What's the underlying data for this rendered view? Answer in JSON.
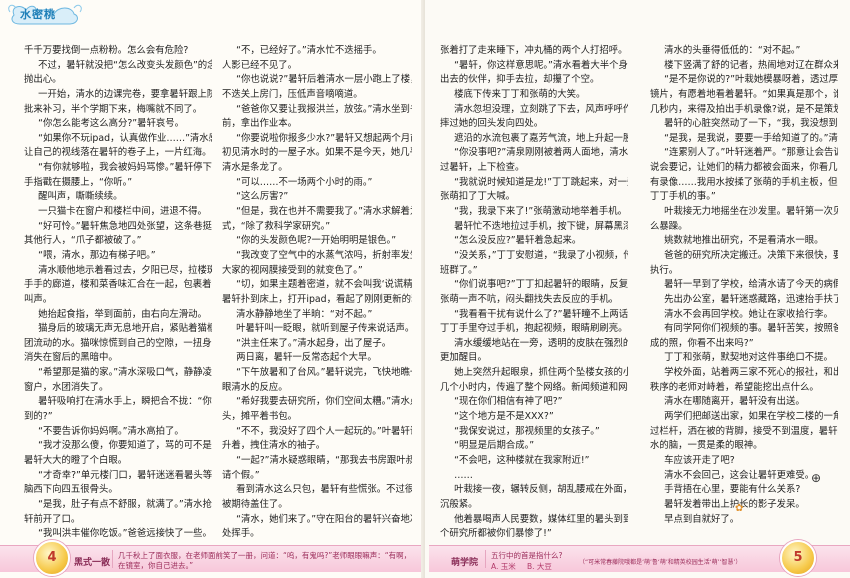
{
  "magazine": {
    "logo": "水密桃"
  },
  "left_page": {
    "col1": [
      {
        "t": "千千万要找倒一点粉粉。怎么会有危险?",
        "i": false
      },
      {
        "t": "不过，暑轩就没把“怎么改变头发颜色”的念头",
        "i": true
      },
      {
        "t": "抛出心。",
        "i": false
      },
      {
        "t": "一开始，清水的边课完卷，要拿暑轩跟上院外开小",
        "i": true
      },
      {
        "t": "批来补习，半个学期下来，梅嘴就不同了。",
        "i": false
      },
      {
        "t": "“你怎么能考这么高分?”暑轩哀号。",
        "i": true
      },
      {
        "t": "“如果你不玩ipad，认真做作业……”清水感复不",
        "i": true
      },
      {
        "t": "让自己的视线落在暑轩的卷子上，一片红海。",
        "i": false
      },
      {
        "t": "“有你就够啦，我会被妈妈骂惨。”暑轩停下来，",
        "i": true
      },
      {
        "t": "手指戳在摄腰上，“你听。”",
        "i": false
      },
      {
        "t": "醒叫声，嘶嘶续续。",
        "i": true
      },
      {
        "t": "一只猫卡在窗户和楼栏中间，进退不得。",
        "i": true
      },
      {
        "t": "“好可怜。”暑轩焦急地四处张望，这条巷挺没有",
        "i": true
      },
      {
        "t": "其他行人，“爪子都被破了。”",
        "i": false
      },
      {
        "t": "“喂，清水，那边有梯子吧。”",
        "i": true
      },
      {
        "t": "清水顺他地示着看过去，夕阳已尽，拉楼斑驳的，挡",
        "i": true
      },
      {
        "t": "手手的廊道，楼和菜香味汇合在一起，包裹着猫的呜",
        "i": false
      },
      {
        "t": "叫声。",
        "i": false
      },
      {
        "t": "她抬起食指，举到面前，由右向左滑动。",
        "i": true
      },
      {
        "t": "猫身后的玻璃无声无息地开启，紧贴着猫框的，是一",
        "i": true
      },
      {
        "t": "团流动的水。猫咪惊慌到自己的空隙，一扭身体，扑通",
        "i": false
      },
      {
        "t": "消失在窗后的黑暗中。",
        "i": false
      },
      {
        "t": "“希望那是猫的家。”清水深吸口气，静静凌着着",
        "i": true
      },
      {
        "t": "窗户，水团消失了。",
        "i": false
      },
      {
        "t": "暑轩吸响打在清水手上，瞬把合不拢：“你怎么做",
        "i": true
      },
      {
        "t": "到的?”",
        "i": false
      },
      {
        "t": "“不要告诉你妈妈啊。”清水高拍了。",
        "i": true
      },
      {
        "t": "“我才没那么傻，你要知道了，骂的可不是你。”",
        "i": true
      },
      {
        "t": "暑轩大大的瞪了个白眼。",
        "i": false
      },
      {
        "t": "“才奇幸?”单元楼门口，暑轩迷迷看暑头等着。",
        "i": true
      },
      {
        "t": "脑西下向四五很骨头。",
        "i": false
      },
      {
        "t": "“是我，肚子有点不舒服，就满了。”清水抢在暑",
        "i": true
      },
      {
        "t": "轩前开了口。",
        "i": false
      },
      {
        "t": "“我叫洪丰催你吃饭。”爸爸远接快了一些。",
        "i": true
      }
    ],
    "col2": [
      {
        "t": "“不，已经好了。”清水忙不迭摇手。",
        "i": true
      },
      {
        "t": "人影已经不见了。",
        "i": false
      },
      {
        "t": "“你也说说?”暑轩后着清水一层小跑上了楼，忙",
        "i": true
      },
      {
        "t": "不迭关上房门，压低声音嘀嘀道。",
        "i": false
      },
      {
        "t": "“爸爸你又要让我报洪兰，放弦。”清水坐到书桌",
        "i": true
      },
      {
        "t": "前，拿出作业本。",
        "i": false
      },
      {
        "t": "“你要说啦你报多少水?”暑轩又想起两个月前，",
        "i": true
      },
      {
        "t": "初见清水时的一屋子水。如果不是今天，她几乎要忘记",
        "i": false
      },
      {
        "t": "清水是条龙了。",
        "i": false
      },
      {
        "t": "“可以……不一场两个小时的雨。”",
        "i": true
      },
      {
        "t": "“这么厉害?”",
        "i": true
      },
      {
        "t": "“但是，我在也并不需要我了。”清水求解着为程",
        "i": true
      },
      {
        "t": "式，“除了救科学家研究。”",
        "i": false
      },
      {
        "t": "“你的头发颜色呢?一开始明明是银色。”",
        "i": true
      },
      {
        "t": "“我改变了空气中的水蒸气浓吗，折射率发生改变，",
        "i": true
      },
      {
        "t": "大家的视网膜接受到的就变色了。”",
        "i": false
      },
      {
        "t": "“切，如果主题着密道，就不会叫我‘说谎精’了。”",
        "i": true
      },
      {
        "t": "暑轩扑到床上，打开ipad，看起了刚刚更新的动画。",
        "i": false
      },
      {
        "t": "清水静静地坐了半晌：“对不起。”",
        "i": true
      },
      {
        "t": "叶暑轩叫一眨眼，就听到屋子传来说话声。",
        "i": true
      },
      {
        "t": "“洪主任来了。”清水起身，出了屋子。",
        "i": true
      },
      {
        "t": "两日离，暑轩一反常态起个大早。",
        "i": true
      },
      {
        "t": "“下午放暑和了台风。”暑轩说完，飞快地瞧一",
        "i": true
      },
      {
        "t": "眼清水的反应。",
        "i": false
      },
      {
        "t": "“希好我要去研究所，你们空间太糟。”清水点点",
        "i": true
      },
      {
        "t": "头，摊平着书包。",
        "i": false
      },
      {
        "t": "“不不，我没好了四个人一起玩的。”叶暑轩语踢",
        "i": true
      },
      {
        "t": "升着，拽住清水的袖子。",
        "i": false
      },
      {
        "t": "“一起?”清水疑惑眼睛，“那我去书房跟叶叔叔",
        "i": true
      },
      {
        "t": "请个假。”",
        "i": false
      },
      {
        "t": "看到清水这么只包，暑轩有些慌张。不过很快，就",
        "i": true
      },
      {
        "t": "被期待盖住了。",
        "i": false
      },
      {
        "t": "“清水，她们来了。”守在阳台的暑轩兴奋地冲远",
        "i": true
      },
      {
        "t": "处挥手。",
        "i": false
      }
    ],
    "footer": {
      "page_number": "4",
      "section": "黑式一散",
      "question": "几千秋上了面衣服，在老师面前笑了一册，问道：“呜，有鬼吗?”老师眼眼嘛声：“有啊，",
      "question2": "在镜室，你自己进去。”"
    }
  },
  "right_page": {
    "col3": [
      {
        "t": "张着打了走来睡下，冲丸桶的两个人打招呼。",
        "i": false
      },
      {
        "t": "“暑轩，你这样意思呢。”清水看着大半个身子探",
        "i": true
      },
      {
        "t": "出去的伙伴，抑手去拉，却攥了个空。",
        "i": false
      },
      {
        "t": "楼底下传来丁丁和张萌的大笑。",
        "i": true
      },
      {
        "t": "清水忽坦没理，立刻跳了下去，风声呼呼作响，释",
        "i": true
      },
      {
        "t": "摔过她的回头发向四处。",
        "i": false
      },
      {
        "t": "遮沿的水流包裹了嘉芳气流，地上升起一股团浆。",
        "i": true
      },
      {
        "t": "“你没事吧?”清泉刚刚被着两人面地，清水就扣",
        "i": true
      },
      {
        "t": "过暑轩，上下检查。",
        "i": false
      },
      {
        "t": "“我就说时候知道是龙!”丁丁跳起来，对一旁的",
        "i": true
      },
      {
        "t": "张萌扣了丁大喊。",
        "i": false
      },
      {
        "t": "“我，我录下来了!”张萌激动地举着手机。",
        "i": true
      },
      {
        "t": "暑轩忙不迭地拉过手机，按下键，屏幕黑漆漆。",
        "i": true
      },
      {
        "t": "“怎么没反应?”暑轩着急起来。",
        "i": true
      },
      {
        "t": "“没关系，”丁丁安慰道，“我录了小视频，传到",
        "i": true
      },
      {
        "t": "班群了。”",
        "i": false
      },
      {
        "t": "“你们说事吧?”丁丁扣起暑轩的眼睛，反复检查，",
        "i": true
      },
      {
        "t": "张萌一声不吭，闷头翻找失去反应的手机。",
        "i": false
      },
      {
        "t": "“我看看干扰有说什么了?”暑轩瞳不上两话，从",
        "i": true
      },
      {
        "t": "丁丁手里夺过手机，抱起视频，眼睛刷刷亮。",
        "i": false
      },
      {
        "t": "清水缓缓地站在一旁，透明的皮肤在强烈的阳光下，",
        "i": true
      },
      {
        "t": "更加醒目。",
        "i": false
      },
      {
        "t": "她上突然升起眼泉，抓住两个坠楼女孩的小视频，",
        "i": true
      },
      {
        "t": "几个小时内，传遍了整个网络。新闻频道和网络手续升级。",
        "i": false
      },
      {
        "t": "“现在你们相信有神了吧?”",
        "i": true
      },
      {
        "t": "“这个地方是不是XXX?”",
        "i": true
      },
      {
        "t": "“我保安说过，那视频里的女孩子。”",
        "i": true
      },
      {
        "t": "“明显是后期合成。”",
        "i": true
      },
      {
        "t": "“不会吧，这种楼就在我家附近!”",
        "i": true
      },
      {
        "t": "……",
        "i": true
      },
      {
        "t": "叶栽接一夜，辗转反侧，胡乱腰戒在外面，黑脸阴",
        "i": true
      },
      {
        "t": "沉般紧。",
        "i": false
      },
      {
        "t": "他着暴喝声人民要数，媒体红里的暑头到到研究所儿上“整",
        "i": true
      },
      {
        "t": "个研究所都被你们暴惨了!”",
        "i": false
      }
    ],
    "col4": [
      {
        "t": "清水的头垂得低低的：“对不起。”",
        "i": true
      },
      {
        "t": "楼下竖满了舒的记者，热闹地对辽在群众来回。",
        "i": true
      },
      {
        "t": "“是不是你说的?”叶栽她模暴呀着，透过厚厚",
        "i": true
      },
      {
        "t": "镜片，有愿着地看着暑轩。“如果真是那个，谁会在坠楼",
        "i": false
      },
      {
        "t": "几秒内，来得及拍出手机录像?说，是不是策划好的?”",
        "i": false
      },
      {
        "t": "暑轩的心脏突然动了一下，“我，我没想到……”",
        "i": true
      },
      {
        "t": "“是我，是我说，要要一手给知道了的。”清水说。",
        "i": true
      },
      {
        "t": "“连累别人了。”叶轩迷着严。“那意让会告诉你了，就",
        "i": true
      },
      {
        "t": "说会要记，让她们的精力都被会面来，你看几天，不",
        "i": false
      },
      {
        "t": "有录像……我用水按揉了张萌的手机主板，但不知道",
        "i": false
      },
      {
        "t": "丁丁手机的事。”",
        "i": false
      },
      {
        "t": "叶栽接无力地摇坐在沙发里。暑轩第一次见到他这",
        "i": true
      },
      {
        "t": "么暴躁。",
        "i": false
      },
      {
        "t": "姚数就地推出研究，不是看清水一眼。",
        "i": true
      },
      {
        "t": "爸爸的研究所决定搬迁。决策下来很快，要求立刻",
        "i": true
      },
      {
        "t": "执行。",
        "i": false
      },
      {
        "t": "暑轩一早到了学校，给清水请了今天的病假。",
        "i": true
      },
      {
        "t": "先出办公室，暑轩迷惑藏路，迅速抬手扶了下眼睛。",
        "i": true
      },
      {
        "t": "清水不会再回学校。她让在家收拾行李。",
        "i": true
      },
      {
        "t": "有同学阿你们视频的事。暑轩苦笑，按照爸爸教的“合",
        "i": true
      },
      {
        "t": "成的照，你看不出来吗?”",
        "i": false
      },
      {
        "t": "丁丁和张萌，默契地对这件事绝口不提。",
        "i": true
      },
      {
        "t": "学校外面，站着两三家不死心的报社，和出去维护",
        "i": true
      },
      {
        "t": "秩序的老师对峙着，希望能挖出点什么。",
        "i": false
      },
      {
        "t": "清水在哪随离开，暑轩没有出送。",
        "i": true
      },
      {
        "t": "两学们把邮送出家，如果在学校二楼的一角，夕阳透",
        "i": true
      },
      {
        "t": "过栏杆，洒在被的背脚，接受不到温度，暑轩看着到了清",
        "i": false
      },
      {
        "t": "水的脑，一贯是柔的眼神。",
        "i": false
      },
      {
        "t": "车应该开走了吧?",
        "i": true
      },
      {
        "t": "清水不会回己，这会让暑轩更难受。",
        "i": true
      },
      {
        "t": "手背捂在心里，要能有什么关系?",
        "i": true
      },
      {
        "t": "暑轩发着带出上护长的影子发呆。",
        "i": true
      },
      {
        "t": "早点到自就好了。",
        "i": true
      }
    ],
    "footer": {
      "page_number": "5",
      "section": "萌学院",
      "question": "五行中的首是指什么?",
      "option_a": "A. 玉米",
      "option_b": "B. 大豆",
      "note": "（“可米常春藤院哦都是‘萌’鲁‘萌’和精英校园生活‘萌’‘智慧’）"
    }
  }
}
